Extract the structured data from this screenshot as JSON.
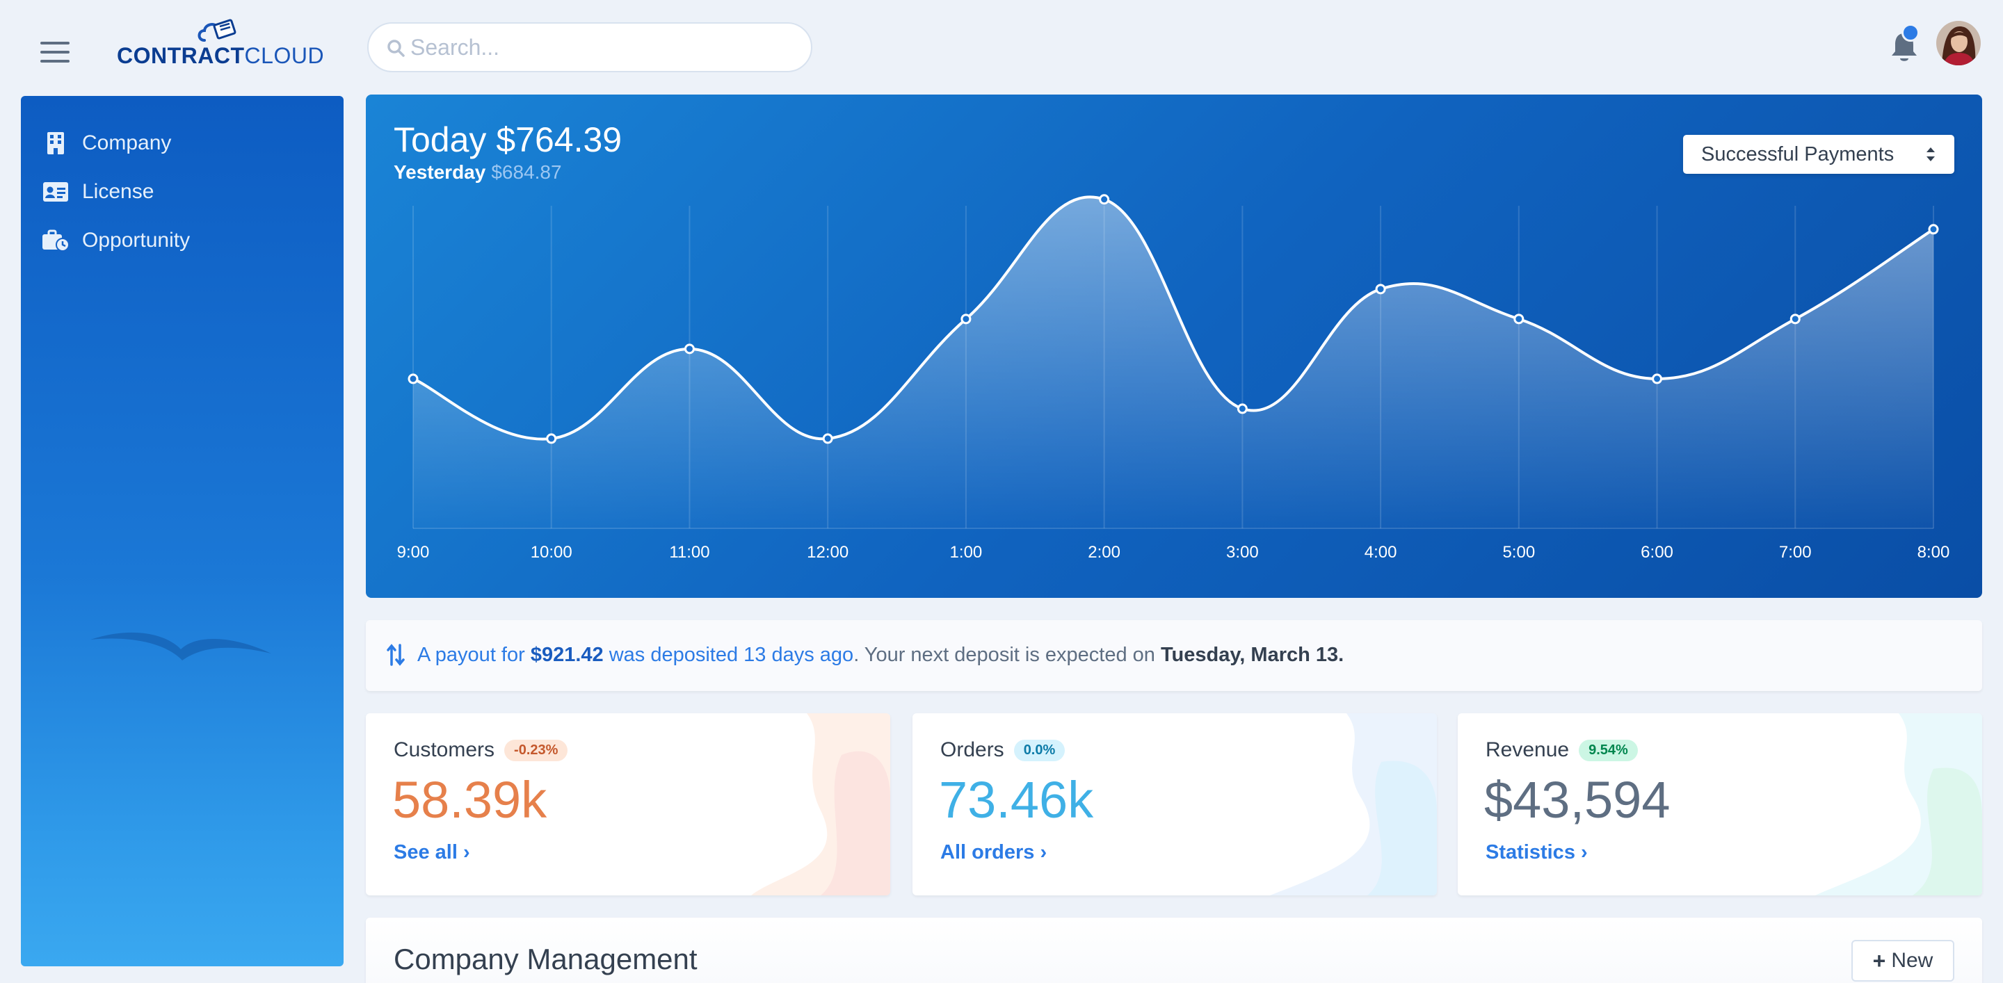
{
  "app": {
    "logo_bold": "CONTRACT",
    "logo_light": "CLOUD"
  },
  "header": {
    "search_placeholder": "Search..."
  },
  "sidebar": {
    "items": [
      {
        "label": "Company",
        "icon": "building-icon"
      },
      {
        "label": "License",
        "icon": "id-card-icon"
      },
      {
        "label": "Opportunity",
        "icon": "business-time-icon"
      }
    ]
  },
  "payments": {
    "today_label": "Today",
    "today_value": "$764.39",
    "yesterday_label": "Yesterday",
    "yesterday_value": "$684.87",
    "filter_selected": "Successful Payments"
  },
  "chart_data": {
    "type": "line",
    "categories": [
      "9:00",
      "10:00",
      "11:00",
      "12:00",
      "1:00",
      "2:00",
      "3:00",
      "4:00",
      "5:00",
      "6:00",
      "7:00",
      "8:00"
    ],
    "values": [
      20,
      12,
      24,
      12,
      28,
      44,
      16,
      32,
      28,
      20,
      28,
      40
    ],
    "ylim": [
      0,
      45
    ],
    "grid": "vertical",
    "line_color": "#ffffff"
  },
  "banner": {
    "prefix": "A payout for ",
    "amount": "$921.42",
    "middle": " was deposited 13 days ago",
    "rest": ". Your next deposit is expected on ",
    "date": "Tuesday, March 13."
  },
  "stats": [
    {
      "title": "Customers",
      "badge": "-0.23%",
      "value": "58.39k",
      "link": "See all",
      "value_color": "#e6804b",
      "badge_bg": "#fde6d8",
      "badge_color": "#c4582c"
    },
    {
      "title": "Orders",
      "badge": "0.0%",
      "value": "73.46k",
      "link": "All orders",
      "value_color": "#3fb0e6",
      "badge_bg": "#d5f2fd",
      "badge_color": "#0d7ba8"
    },
    {
      "title": "Revenue",
      "badge": "9.54%",
      "value": "$43,594",
      "link": "Statistics",
      "value_color": "#5e6e82",
      "badge_bg": "#ccf6e4",
      "badge_color": "#00864e"
    }
  ],
  "management": {
    "title": "Company Management",
    "new_label": "New"
  }
}
